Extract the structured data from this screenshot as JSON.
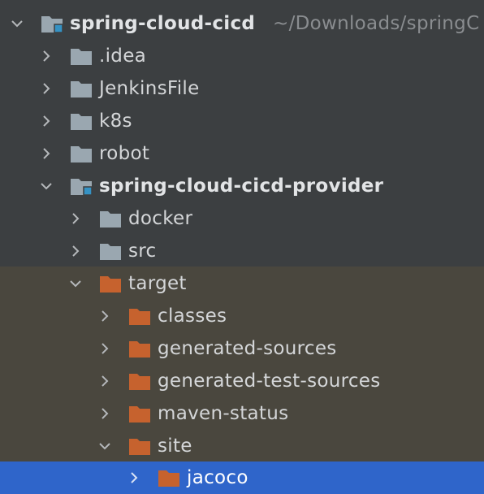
{
  "tree": {
    "root": {
      "label": "spring-cloud-cicd",
      "path": "~/Downloads/springC"
    },
    "items": [
      {
        "label": ".idea"
      },
      {
        "label": "JenkinsFile"
      },
      {
        "label": "k8s"
      },
      {
        "label": "robot"
      },
      {
        "label": "spring-cloud-cicd-provider"
      },
      {
        "label": "docker"
      },
      {
        "label": "src"
      },
      {
        "label": "target"
      },
      {
        "label": "classes"
      },
      {
        "label": "generated-sources"
      },
      {
        "label": "generated-test-sources"
      },
      {
        "label": "maven-status"
      },
      {
        "label": "site"
      },
      {
        "label": "jacoco"
      }
    ]
  },
  "colors": {
    "background": "#3c3f41",
    "excluded_background": "#4a473e",
    "selection": "#2f65ca",
    "folder_gray": "#9aa7b0",
    "folder_excluded": "#c6622e",
    "module_badge": "#3592c4"
  },
  "icons": {
    "expanded": "chevron-down-icon",
    "collapsed": "chevron-right-icon",
    "folder": "folder-icon",
    "module_folder": "module-folder-icon",
    "excluded_folder": "excluded-folder-icon"
  }
}
